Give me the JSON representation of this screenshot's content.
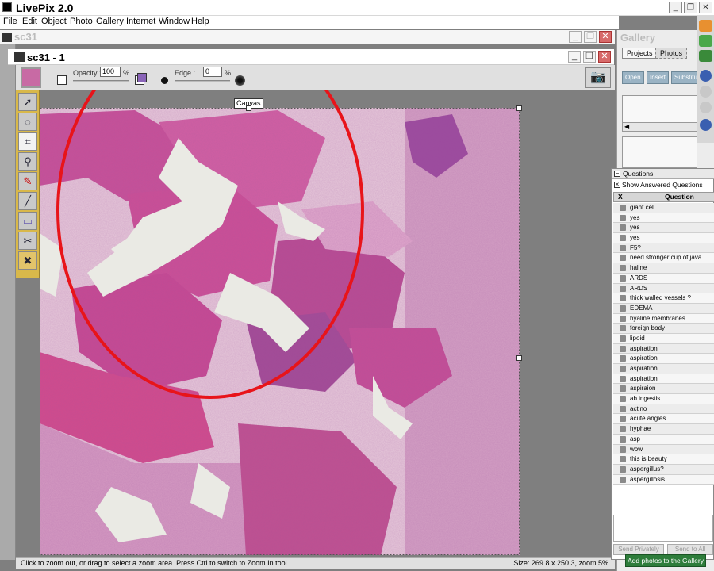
{
  "app": {
    "title": "LivePix 2.0"
  },
  "window_controls": {
    "minimize": "_",
    "restore": "❐",
    "close": "✕"
  },
  "menu": [
    "File",
    "Edit",
    "Object",
    "Photo",
    "Gallery",
    "Internet",
    "Window",
    "Help"
  ],
  "outer_doc": {
    "title": "sc31"
  },
  "inner_doc": {
    "title": "sc31 - 1"
  },
  "properties": {
    "opacity_label": "Opacity :",
    "opacity_value": "100",
    "opacity_unit": "%",
    "edge_label": "Edge :",
    "edge_value": "0",
    "edge_unit": "%"
  },
  "canvas": {
    "label": "Canvas"
  },
  "tools": [
    "arrow-select-icon",
    "lasso-icon",
    "crop-icon",
    "zoom-icon",
    "paint-icon",
    "line-icon",
    "rectangle-icon",
    "clone-icon",
    "eraser-icon"
  ],
  "status": {
    "hint": "Click to zoom out, or drag to select a zoom area. Press Ctrl to switch to Zoom In tool.",
    "size": "Size: 269.8 x 250.3, zoom 5%"
  },
  "gallery": {
    "title": "Gallery",
    "tabs": [
      "Projects",
      "Photos"
    ],
    "active_tab": "Photos",
    "buttons": [
      "Open",
      "Insert",
      "Substitute"
    ]
  },
  "questions": {
    "title": "Questions",
    "show_answered_label": "Show Answered Questions",
    "show_answered_checked": true,
    "col_x": "X",
    "col_question": "Question",
    "items": [
      "giant cell",
      "yes",
      "yes",
      "yes",
      "F5?",
      "need stronger cup of java",
      "haline",
      "ARDS",
      "ARDS",
      "thick walled vessels ?",
      "EDEMA",
      "hyaline membranes",
      "foreign body",
      "lipoid",
      "aspiration",
      "aspiration",
      "aspiration",
      "aspiration",
      "aspiraion",
      "ab ingestis",
      "actino",
      "acute angles",
      "hyphae",
      "asp",
      "wow",
      "this is beauty",
      "aspergillus?",
      "aspergillosis"
    ],
    "send_privately": "Send Privately",
    "send_all": "Send to All"
  },
  "add_photos_button": "Add photos to the Gallery",
  "colors": {
    "annotation_circle": "#e8141a",
    "accent_green": "#2e7d3b",
    "tissue_pink": "#c0508e",
    "tissue_purple": "#6a4b9c"
  }
}
